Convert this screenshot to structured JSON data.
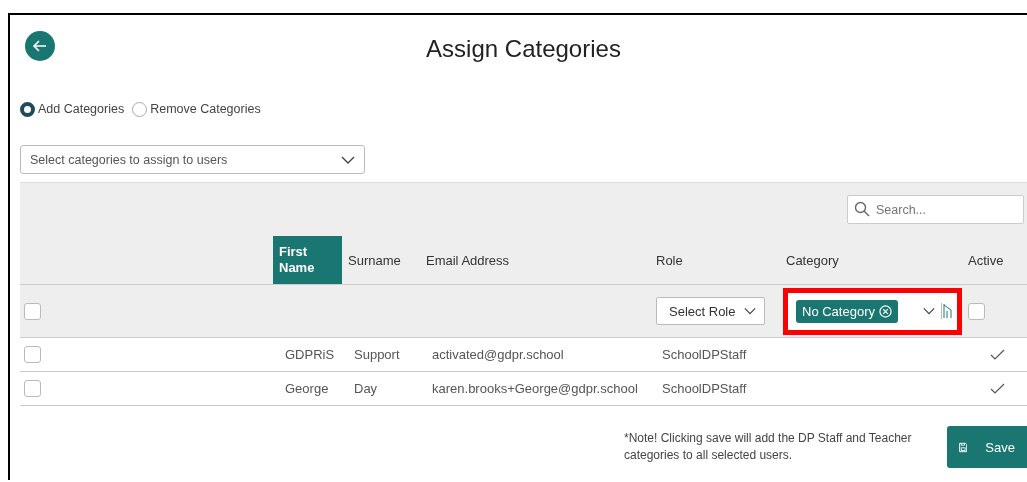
{
  "title": "Assign Categories",
  "mode_options": [
    {
      "label": "Add Categories",
      "selected": true
    },
    {
      "label": "Remove Categories",
      "selected": false
    }
  ],
  "category_select": {
    "placeholder": "Select categories to assign to users"
  },
  "search": {
    "placeholder": "Search..."
  },
  "columns": [
    {
      "label": "First Name",
      "sorted": true
    },
    {
      "label": "Surname",
      "sorted": false
    },
    {
      "label": "Email Address",
      "sorted": false
    },
    {
      "label": "Role",
      "sorted": false
    },
    {
      "label": "Category",
      "sorted": false
    },
    {
      "label": "Active",
      "sorted": false
    }
  ],
  "filter_row": {
    "checked": false,
    "role_select": "Select Role",
    "category_chip": "No Category",
    "category_highlighted": true,
    "active_checked": false
  },
  "rows": [
    {
      "checked": false,
      "first_name": "GDPRiS",
      "surname": "Support",
      "email": "activated@gdpr.school",
      "role": "SchoolDPStaff",
      "active": true
    },
    {
      "checked": false,
      "first_name": "George",
      "surname": "Day",
      "email": "karen.brooks+George@gdpr.school",
      "role": "SchoolDPStaff",
      "active": true
    }
  ],
  "note": "*Note! Clicking save will add the DP Staff and Teacher categories to all selected users.",
  "save_button": "Save"
}
